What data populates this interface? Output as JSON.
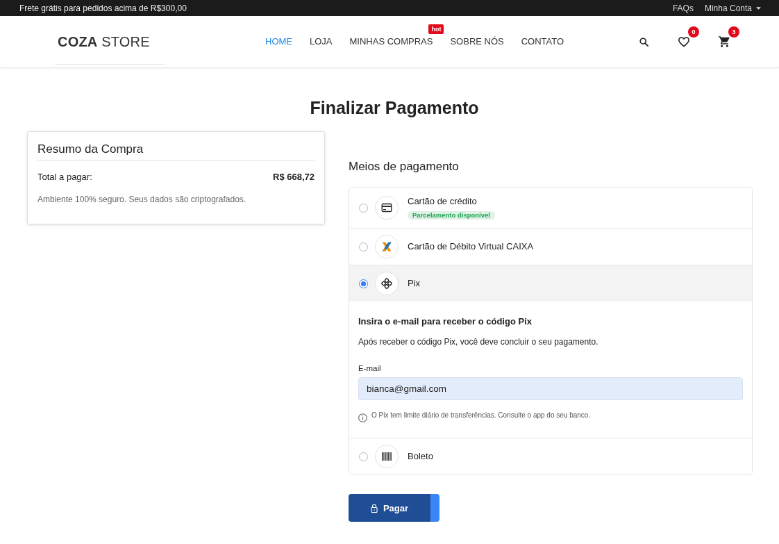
{
  "top_bar": {
    "promo": "Frete grátis para pedidos acima de R$300,00",
    "links": [
      {
        "label": "FAQs",
        "kind": "link"
      },
      {
        "label": "Minha Conta",
        "kind": "dropdown"
      }
    ]
  },
  "header": {
    "logo": "**COZA** STORE",
    "nav": [
      {
        "label": "HOME",
        "selected": true
      },
      {
        "label": "LOJA",
        "selected": false
      },
      {
        "label": "MINHAS COMPRAS",
        "selected": false,
        "badge": "hot"
      },
      {
        "label": "SOBRE NÓS",
        "selected": false
      },
      {
        "label": "CONTATO",
        "selected": false
      }
    ],
    "actions": [
      {
        "kind": "search"
      },
      {
        "kind": "wishlist",
        "count": "0"
      },
      {
        "kind": "cart",
        "count": "3"
      }
    ]
  },
  "page_title": "Finalizar Pagamento",
  "summary": {
    "title": "Resumo da Compra",
    "total_label": "Total a pagar:",
    "total_value": "R$ 668,72",
    "note": "Ambiente 100% seguro. Seus dados são criptografados."
  },
  "payment": {
    "title": "Meios de pagamento",
    "methods": [
      {
        "kind": "credit_card",
        "label": "Cartão de crédito",
        "selected": false,
        "badge": "Parcelamento disponível"
      },
      {
        "kind": "caixa",
        "label": "Cartão de Débito Virtual CAIXA",
        "selected": false
      },
      {
        "kind": "pix",
        "label": "Pix",
        "selected": true,
        "details": {
          "heading": "Insira o e-mail para receber o código Pix",
          "text": "Após receber o código Pix, você deve concluir o seu pagamento.",
          "field_label": "E-mail",
          "value": "bianca@gmail.com",
          "hint": "O Pix tem limite diário de transferências. Consulte o app do seu banco."
        }
      },
      {
        "kind": "boleto",
        "label": "Boleto",
        "selected": false
      }
    ]
  },
  "pay_button": {
    "label": "Pagar"
  }
}
